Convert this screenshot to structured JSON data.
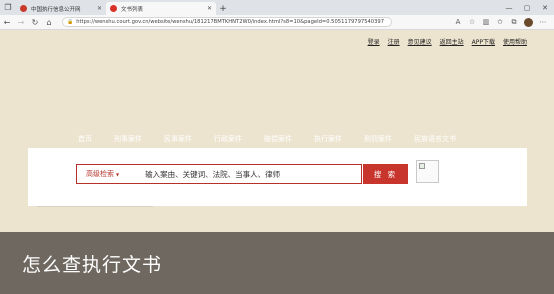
{
  "browser": {
    "tabs": [
      {
        "title": "中国执行信息公开网",
        "active": false
      },
      {
        "title": "文书列表",
        "active": true
      }
    ],
    "url": "https://wenshu.court.gov.cn/website/wenshu/181217BMTKHNT2W0/index.html?s8=10&pageId=0.5051179797540397",
    "new_tab_symbol": "+"
  },
  "page": {
    "top_links": [
      "登录",
      "注册",
      "意见建议",
      "返回主站",
      "APP下载",
      "使用帮助"
    ],
    "main_nav": [
      "首页",
      "刑事案件",
      "民事案件",
      "行政案件",
      "赔偿案件",
      "执行案件",
      "刑罚案件",
      "民族语言文书"
    ],
    "search": {
      "advanced_label": "高级检索",
      "placeholder": "输入案由、关键词、法院、当事人、律师",
      "button_label": "搜 索"
    }
  },
  "caption": {
    "text": "怎么查执行文书"
  },
  "colors": {
    "page_bg": "#ede4d0",
    "accent_red": "#c8352d",
    "caption_bg": "#6e6860"
  }
}
